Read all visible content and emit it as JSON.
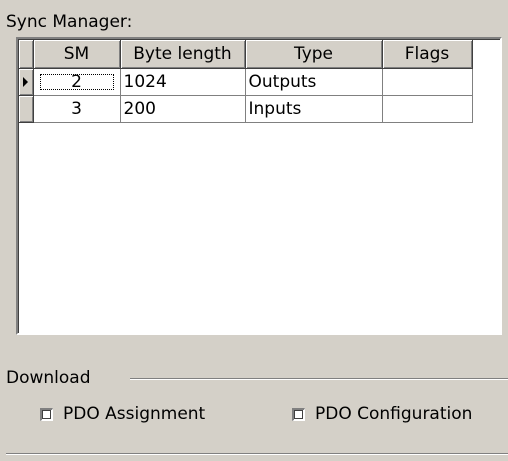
{
  "sync_manager": {
    "label": "Sync Manager:",
    "columns": [
      "SM",
      "Byte length",
      "Type",
      "Flags"
    ],
    "rows": [
      {
        "sm": "2",
        "byte_length": "1024",
        "type": "Outputs",
        "flags": ""
      },
      {
        "sm": "3",
        "byte_length": "200",
        "type": "Inputs",
        "flags": ""
      }
    ]
  },
  "download": {
    "title": "Download",
    "pdo_assignment_label": "PDO Assignment",
    "pdo_assignment_checked": false,
    "pdo_configuration_label": "PDO Configuration",
    "pdo_configuration_checked": false
  }
}
